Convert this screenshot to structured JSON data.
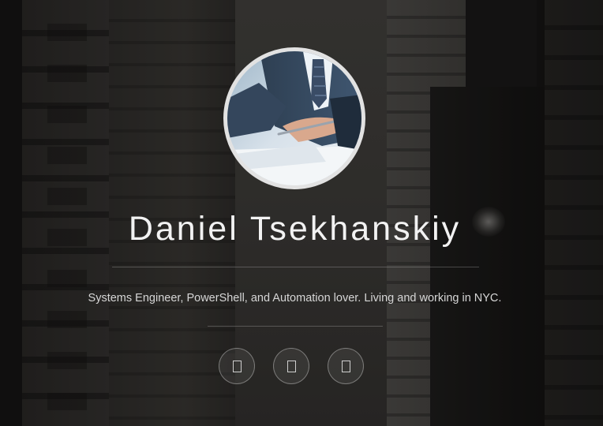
{
  "profile": {
    "name": "Daniel Tsekhanskiy",
    "tagline": "Systems Engineer, PowerShell, and Automation lover. Living and working in NYC."
  },
  "social_links": [
    {
      "icon": "social-link-icon-1"
    },
    {
      "icon": "social-link-icon-2"
    },
    {
      "icon": "social-link-icon-3"
    }
  ],
  "colors": {
    "text_primary": "#f2f2f2",
    "text_secondary": "#d6d6d6",
    "avatar_border": "#e2e2e2"
  }
}
